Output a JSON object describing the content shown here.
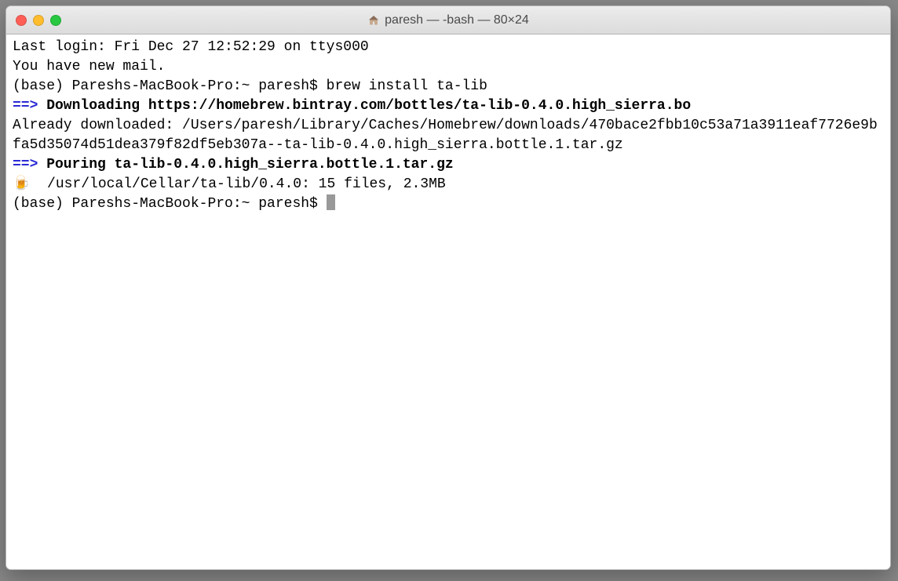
{
  "titlebar": {
    "title": "paresh — -bash — 80×24"
  },
  "terminal": {
    "lastLogin": "Last login: Fri Dec 27 12:52:29 on ttys000",
    "mailNotice": "You have new mail.",
    "prompt1_prefix": "(base) Pareshs-MacBook-Pro:~ paresh$ ",
    "command1": "brew install ta-lib",
    "arrow": "==>",
    "downloading_label": " Downloading https://homebrew.bintray.com/bottles/ta-lib-0.4.0.high_sierra.bo",
    "alreadyDownloaded": "Already downloaded: /Users/paresh/Library/Caches/Homebrew/downloads/470bace2fbb10c53a71a3911eaf7726e9bfa5d35074d51dea379f82df5eb307a--ta-lib-0.4.0.high_sierra.bottle.1.tar.gz",
    "pouring_label": " Pouring ta-lib-0.4.0.high_sierra.bottle.1.tar.gz",
    "beer_emoji": "🍺",
    "install_result": "  /usr/local/Cellar/ta-lib/0.4.0: 15 files, 2.3MB",
    "prompt2": "(base) Pareshs-MacBook-Pro:~ paresh$ "
  }
}
